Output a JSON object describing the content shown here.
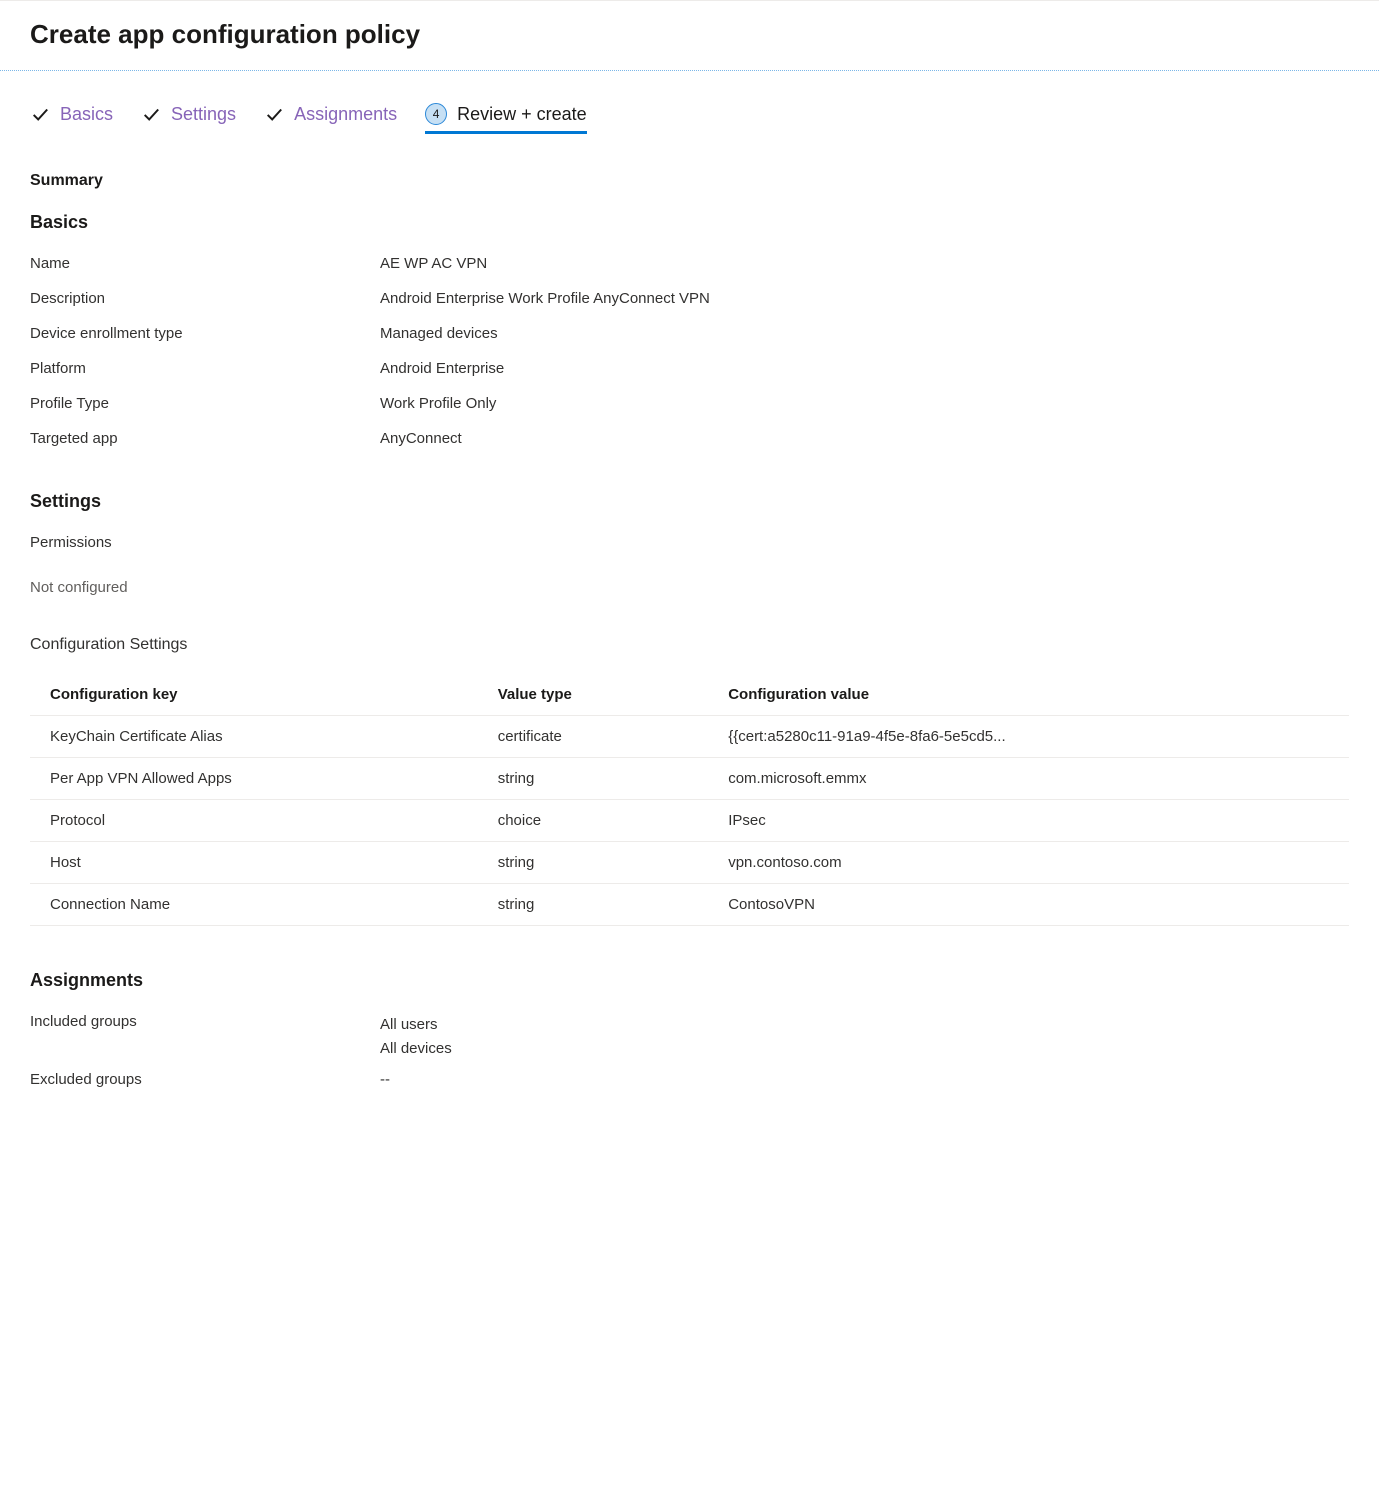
{
  "header": {
    "title": "Create app configuration policy"
  },
  "tabs": [
    {
      "label": "Basics",
      "state": "completed"
    },
    {
      "label": "Settings",
      "state": "completed"
    },
    {
      "label": "Assignments",
      "state": "completed"
    },
    {
      "label": "Review + create",
      "state": "current",
      "step_number": "4"
    }
  ],
  "summary": {
    "heading": "Summary"
  },
  "sections": {
    "basics": {
      "heading": "Basics",
      "rows": [
        {
          "label": "Name",
          "value": "AE WP AC VPN"
        },
        {
          "label": "Description",
          "value": "Android Enterprise Work Profile AnyConnect VPN"
        },
        {
          "label": "Device enrollment type",
          "value": "Managed devices"
        },
        {
          "label": "Platform",
          "value": "Android Enterprise"
        },
        {
          "label": "Profile Type",
          "value": "Work Profile Only"
        },
        {
          "label": "Targeted app",
          "value": "AnyConnect"
        }
      ]
    },
    "settings": {
      "heading": "Settings",
      "permissions_label": "Permissions",
      "permissions_value": "Not configured",
      "config_settings_heading": "Configuration Settings",
      "config_table": {
        "headers": {
          "key": "Configuration key",
          "type": "Value type",
          "value": "Configuration value"
        },
        "rows": [
          {
            "key": "KeyChain Certificate Alias",
            "type": "certificate",
            "value": "{{cert:a5280c11-91a9-4f5e-8fa6-5e5cd5..."
          },
          {
            "key": "Per App VPN Allowed Apps",
            "type": "string",
            "value": "com.microsoft.emmx"
          },
          {
            "key": "Protocol",
            "type": "choice",
            "value": "IPsec"
          },
          {
            "key": "Host",
            "type": "string",
            "value": "vpn.contoso.com"
          },
          {
            "key": "Connection Name",
            "type": "string",
            "value": "ContosoVPN"
          }
        ]
      }
    },
    "assignments": {
      "heading": "Assignments",
      "included_label": "Included groups",
      "included_values": [
        "All users",
        "All devices"
      ],
      "excluded_label": "Excluded groups",
      "excluded_value": "--"
    }
  }
}
